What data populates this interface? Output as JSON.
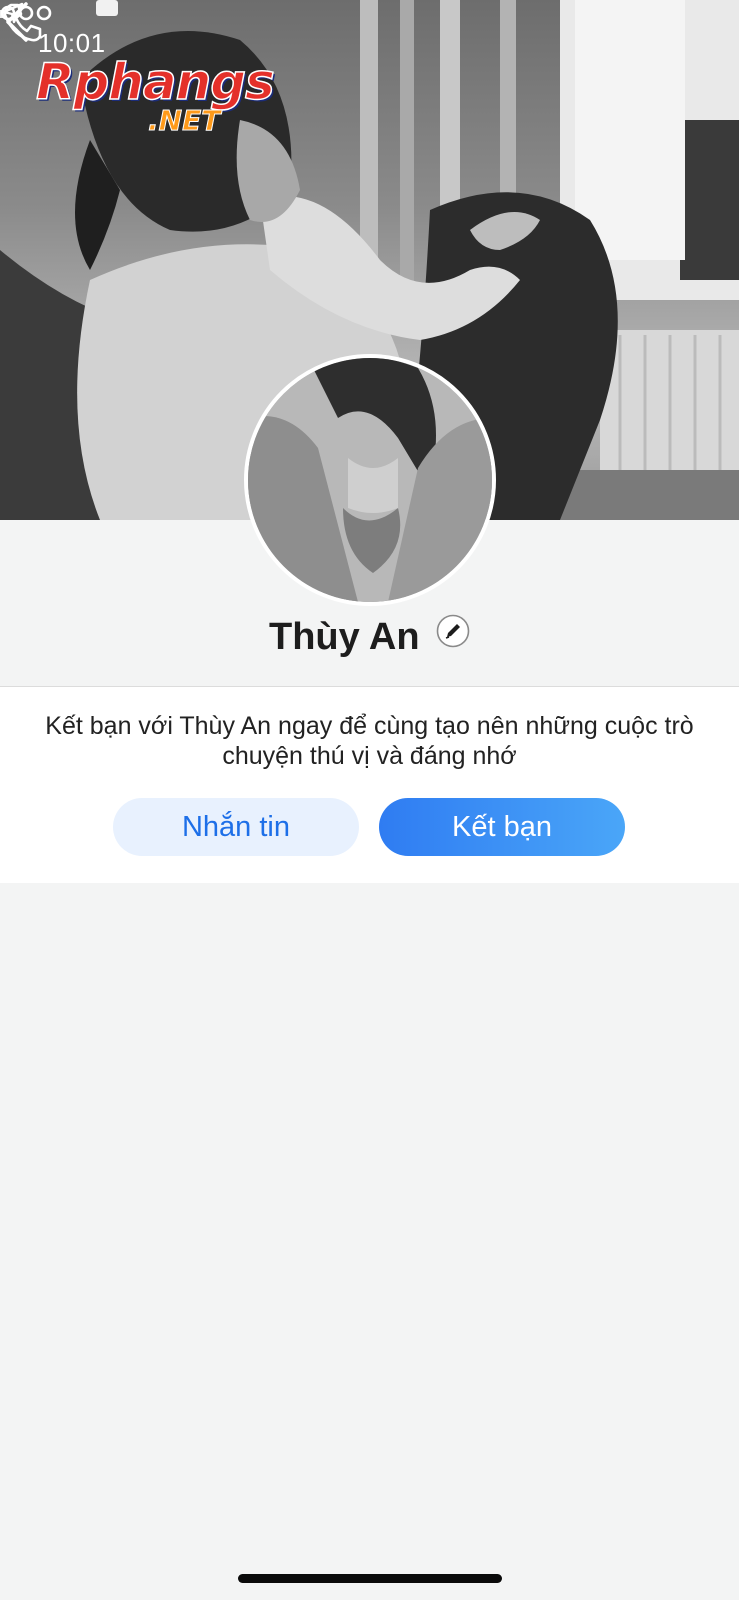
{
  "status_bar": {
    "time": "10:01"
  },
  "watermark": {
    "brand": "Rphangs",
    "domain": ".NET"
  },
  "nav": {
    "back_icon": "chevron-left-icon",
    "call_icon": "phone-icon",
    "more_icon": "more-dots-icon"
  },
  "profile": {
    "name": "Thùy An",
    "edit_icon": "pencil-icon"
  },
  "invite": {
    "message": "Kết bạn với Thùy An ngay để cùng tạo nên những cuộc trò chuyện thú vị và đáng nhớ",
    "message_button": "Nhắn tin",
    "add_friend_button": "Kết bạn"
  },
  "colors": {
    "primary": "#2f7cf2",
    "primary_light": "#e8f1fe",
    "background": "#f3f4f4",
    "panel": "#ffffff"
  }
}
